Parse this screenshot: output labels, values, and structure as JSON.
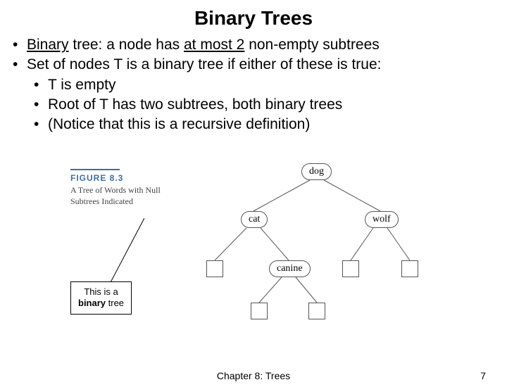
{
  "title": "Binary Trees",
  "bullets": {
    "b1_prefix": "Binary",
    "b1_mid": " tree: a node has ",
    "b1_under2": "at most 2",
    "b1_suffix": " non-empty subtrees",
    "b2": "Set of nodes T is a binary tree if either of these is true:",
    "s1": "T is empty",
    "s2": "Root of T has two subtrees, both binary trees",
    "s3": "(Notice that this is a recursive definition)"
  },
  "figure": {
    "label": "FIGURE 8.3",
    "desc": "A Tree of Words with Null Subtrees Indicated",
    "callout_l1": "This is a",
    "callout_l2_b": "binary",
    "callout_l2_rest": " tree"
  },
  "tree_nodes": {
    "root": "dog",
    "left": "cat",
    "right": "wolf",
    "leftright": "canine"
  },
  "footer": {
    "center": "Chapter 8: Trees",
    "page": "7"
  }
}
